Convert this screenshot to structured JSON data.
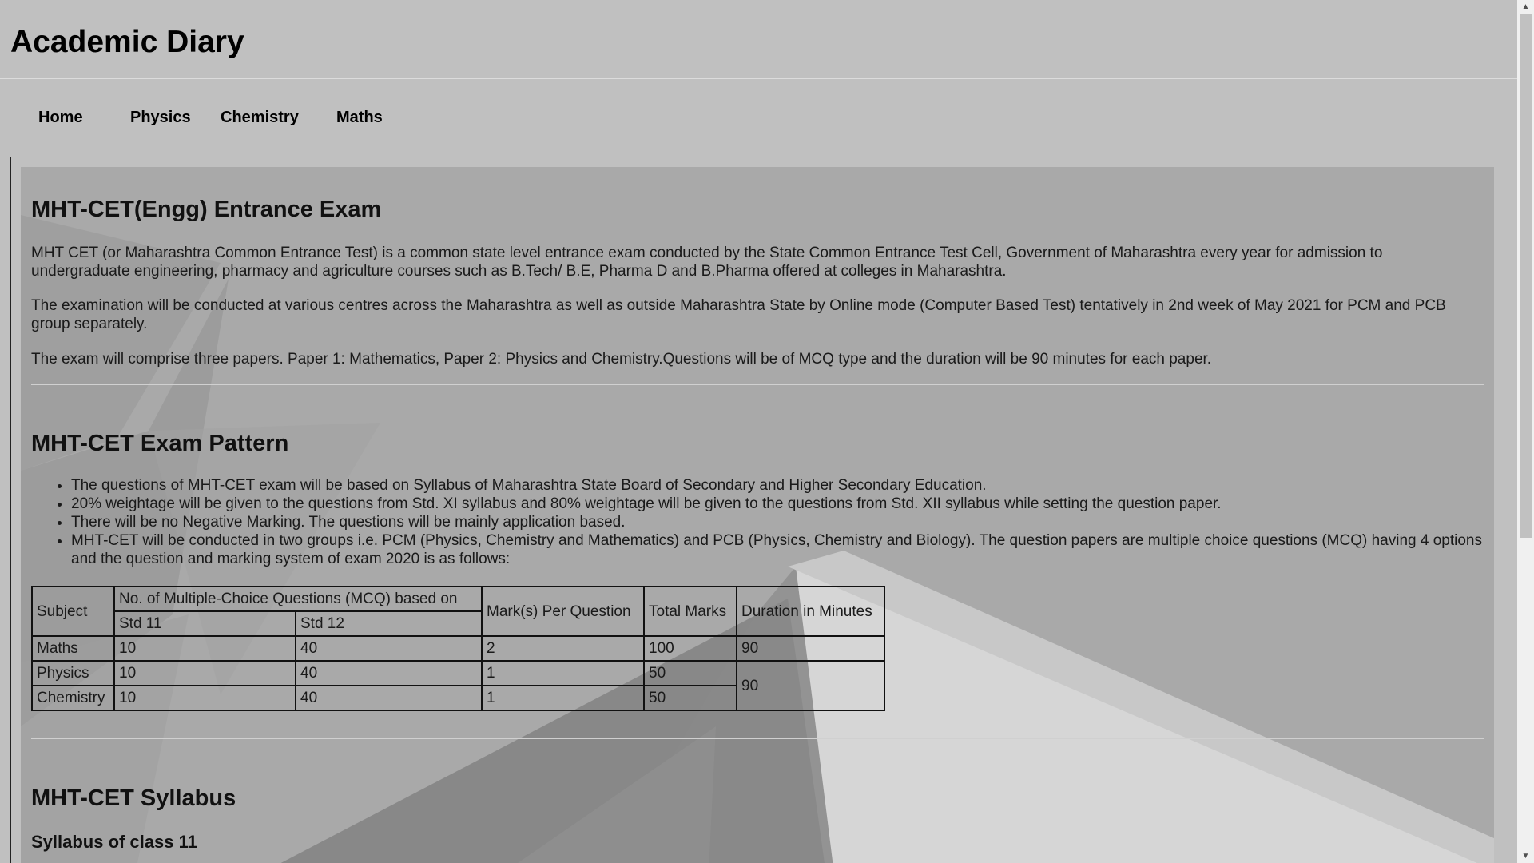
{
  "site": {
    "title": "Academic Diary"
  },
  "nav": {
    "items": [
      {
        "label": "Home"
      },
      {
        "label": "Physics"
      },
      {
        "label": "Chemistry"
      },
      {
        "label": "Maths"
      }
    ]
  },
  "section1": {
    "title": "MHT-CET(Engg) Entrance Exam",
    "p1": "MHT CET (or Maharashtra Common Entrance Test) is a common state level entrance exam conducted by the State Common Entrance Test Cell, Government of Maharashtra every year for admission to undergraduate engineering, pharmacy and agriculture courses such as B.Tech/ B.E, Pharma D and B.Pharma offered at colleges in Maharashtra.",
    "p2": "The examination will be conducted at various centres across the Maharashtra as well as outside Maharashtra State by Online mode (Computer Based Test) tentatively in 2nd week of May 2021 for PCM and PCB group separately.",
    "p3": "The exam will comprise three papers. Paper 1: Mathematics, Paper 2: Physics and Chemistry.Questions will be of MCQ type and the duration will be 90 minutes for each paper."
  },
  "section2": {
    "title": "MHT-CET Exam Pattern",
    "bullets": [
      "The questions of MHT-CET exam will be based on Syllabus of Maharashtra State Board of Secondary and Higher Secondary Education.",
      "20% weightage will be given to the questions from Std. XI syllabus and 80% weightage will be given to the questions from Std. XII syllabus while setting the question paper.",
      "There will be no Negative Marking. The questions will be mainly application based.",
      "MHT-CET will be conducted in two groups i.e. PCM (Physics, Chemistry and Mathematics) and PCB (Physics, Chemistry and Biology). The question papers are multiple choice questions (MCQ) having 4 options and the question and marking system of exam 2020 is as follows:"
    ],
    "table": {
      "h_subject": "Subject",
      "h_mcq": "No. of Multiple-Choice Questions (MCQ) based on",
      "h_std11": "Std 11",
      "h_std12": "Std 12",
      "h_marks_per_q": "Mark(s) Per Question",
      "h_total": "Total Marks",
      "h_duration": "Duration in Minutes",
      "rows": [
        {
          "subject": "Maths",
          "std11": "10",
          "std12": "40",
          "marks": "2",
          "total": "100",
          "duration": "90"
        },
        {
          "subject": "Physics",
          "std11": "10",
          "std12": "40",
          "marks": "1",
          "total": "50",
          "duration": "90"
        },
        {
          "subject": "Chemistry",
          "std11": "10",
          "std12": "40",
          "marks": "1",
          "total": "50"
        }
      ]
    }
  },
  "section3": {
    "title": "MHT-CET Syllabus",
    "subtitle": "Syllabus of class 11"
  },
  "scrollbar": {
    "up_arrow": "▲",
    "down_arrow": "▼"
  }
}
